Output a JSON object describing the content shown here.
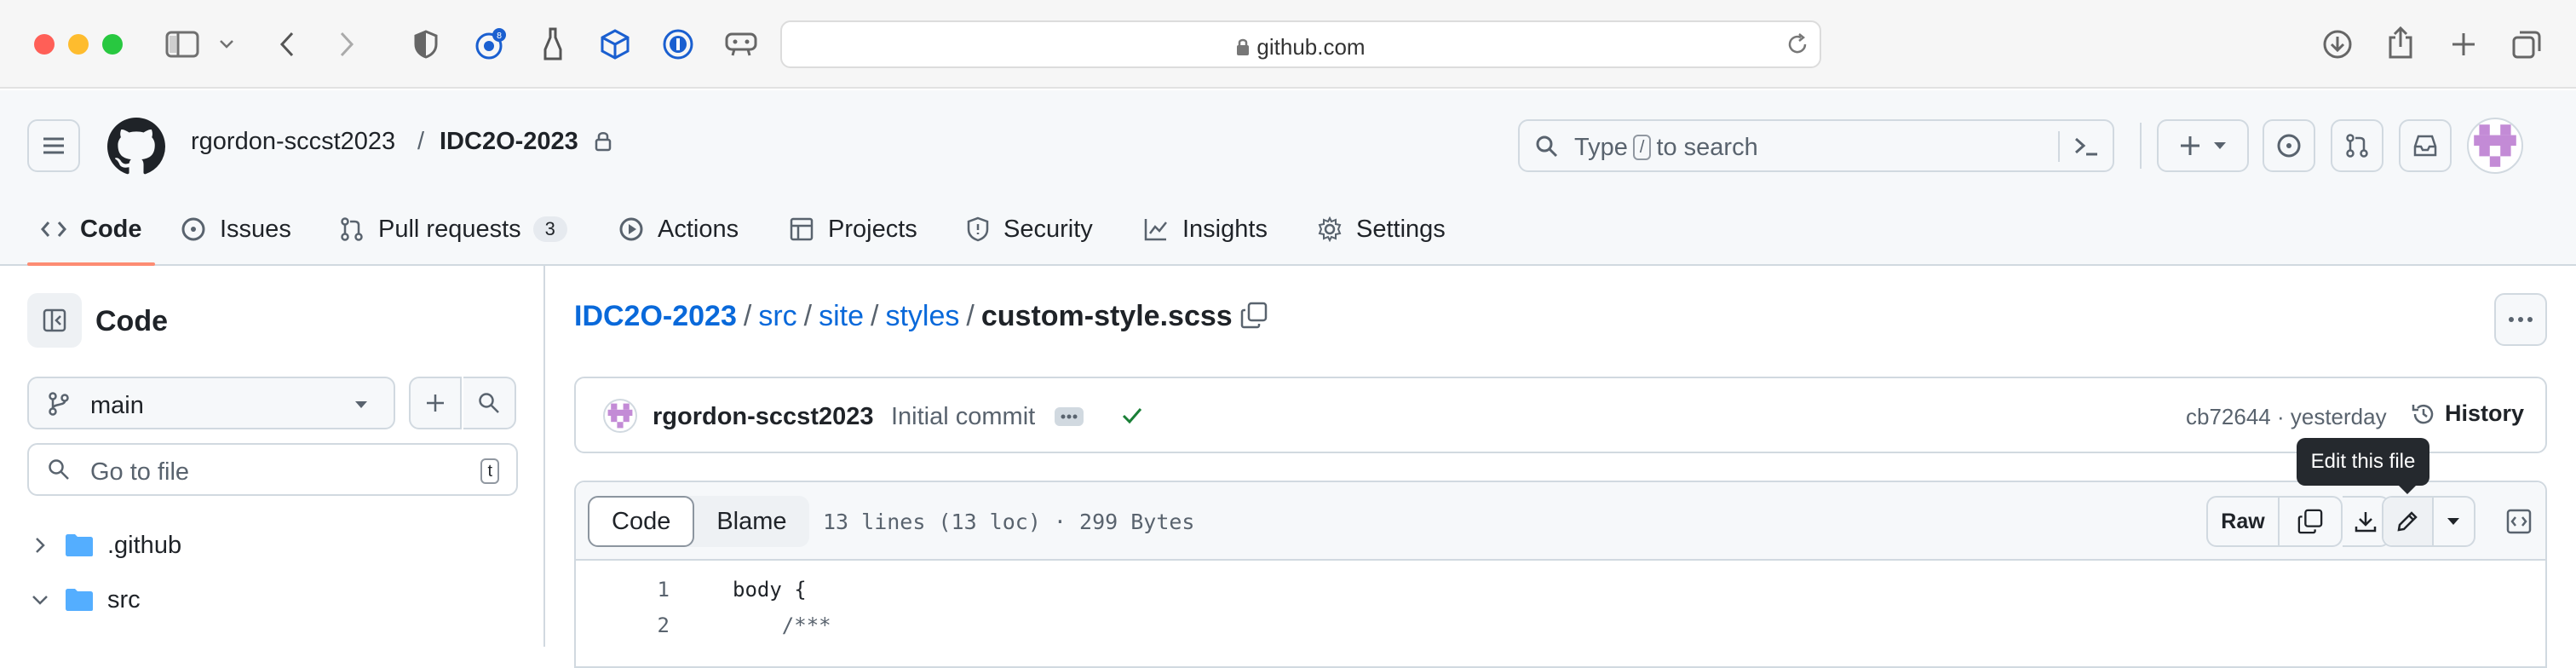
{
  "browser": {
    "url": "github.com",
    "icons": [
      "sidebar-icon",
      "chevron-down-icon",
      "back-icon",
      "forward-icon",
      "shield-icon",
      "extension-icon",
      "bottle-icon",
      "cube-icon",
      "password-icon",
      "game-icon",
      "reload-icon",
      "download-icon",
      "share-icon",
      "new-tab-icon",
      "tab-overview-icon"
    ]
  },
  "header": {
    "owner": "rgordon-sccst2023",
    "separator": "/",
    "repo": "IDC2O-2023",
    "search_prefix": "Type",
    "search_key": "/",
    "search_suffix": "to search"
  },
  "repo_nav": {
    "tabs": [
      {
        "label": "Code",
        "icon": "code-icon"
      },
      {
        "label": "Issues",
        "icon": "issue-icon"
      },
      {
        "label": "Pull requests",
        "icon": "pull-request-icon",
        "count": "3"
      },
      {
        "label": "Actions",
        "icon": "play-icon"
      },
      {
        "label": "Projects",
        "icon": "table-icon"
      },
      {
        "label": "Security",
        "icon": "shield-icon"
      },
      {
        "label": "Insights",
        "icon": "graph-icon"
      },
      {
        "label": "Settings",
        "icon": "gear-icon"
      }
    ],
    "active": "Code"
  },
  "sidebar": {
    "title": "Code",
    "branch": "main",
    "goto_placeholder": "Go to file",
    "goto_key": "t",
    "tree": [
      {
        "name": ".github",
        "expanded": false
      },
      {
        "name": "src",
        "expanded": true
      }
    ]
  },
  "breadcrumb": {
    "parts": [
      "IDC2O-2023",
      "src",
      "site",
      "styles"
    ],
    "separator": "/",
    "file": "custom-style.scss"
  },
  "commit": {
    "author": "rgordon-sccst2023",
    "message": "Initial commit",
    "sha_time": "cb72644 · yesterday",
    "history_label": "History"
  },
  "file": {
    "tab_code": "Code",
    "tab_blame": "Blame",
    "info": "13 lines (13 loc) · 299 Bytes",
    "raw_label": "Raw",
    "tooltip": "Edit this file",
    "lines": [
      {
        "n": "1",
        "text": "body {"
      },
      {
        "n": "2",
        "text": "    /***"
      }
    ]
  },
  "colors": {
    "accent_link": "#0969da",
    "active_tab_underline": "#fd8c73",
    "folder": "#54aeff",
    "success": "#1a7f37"
  }
}
